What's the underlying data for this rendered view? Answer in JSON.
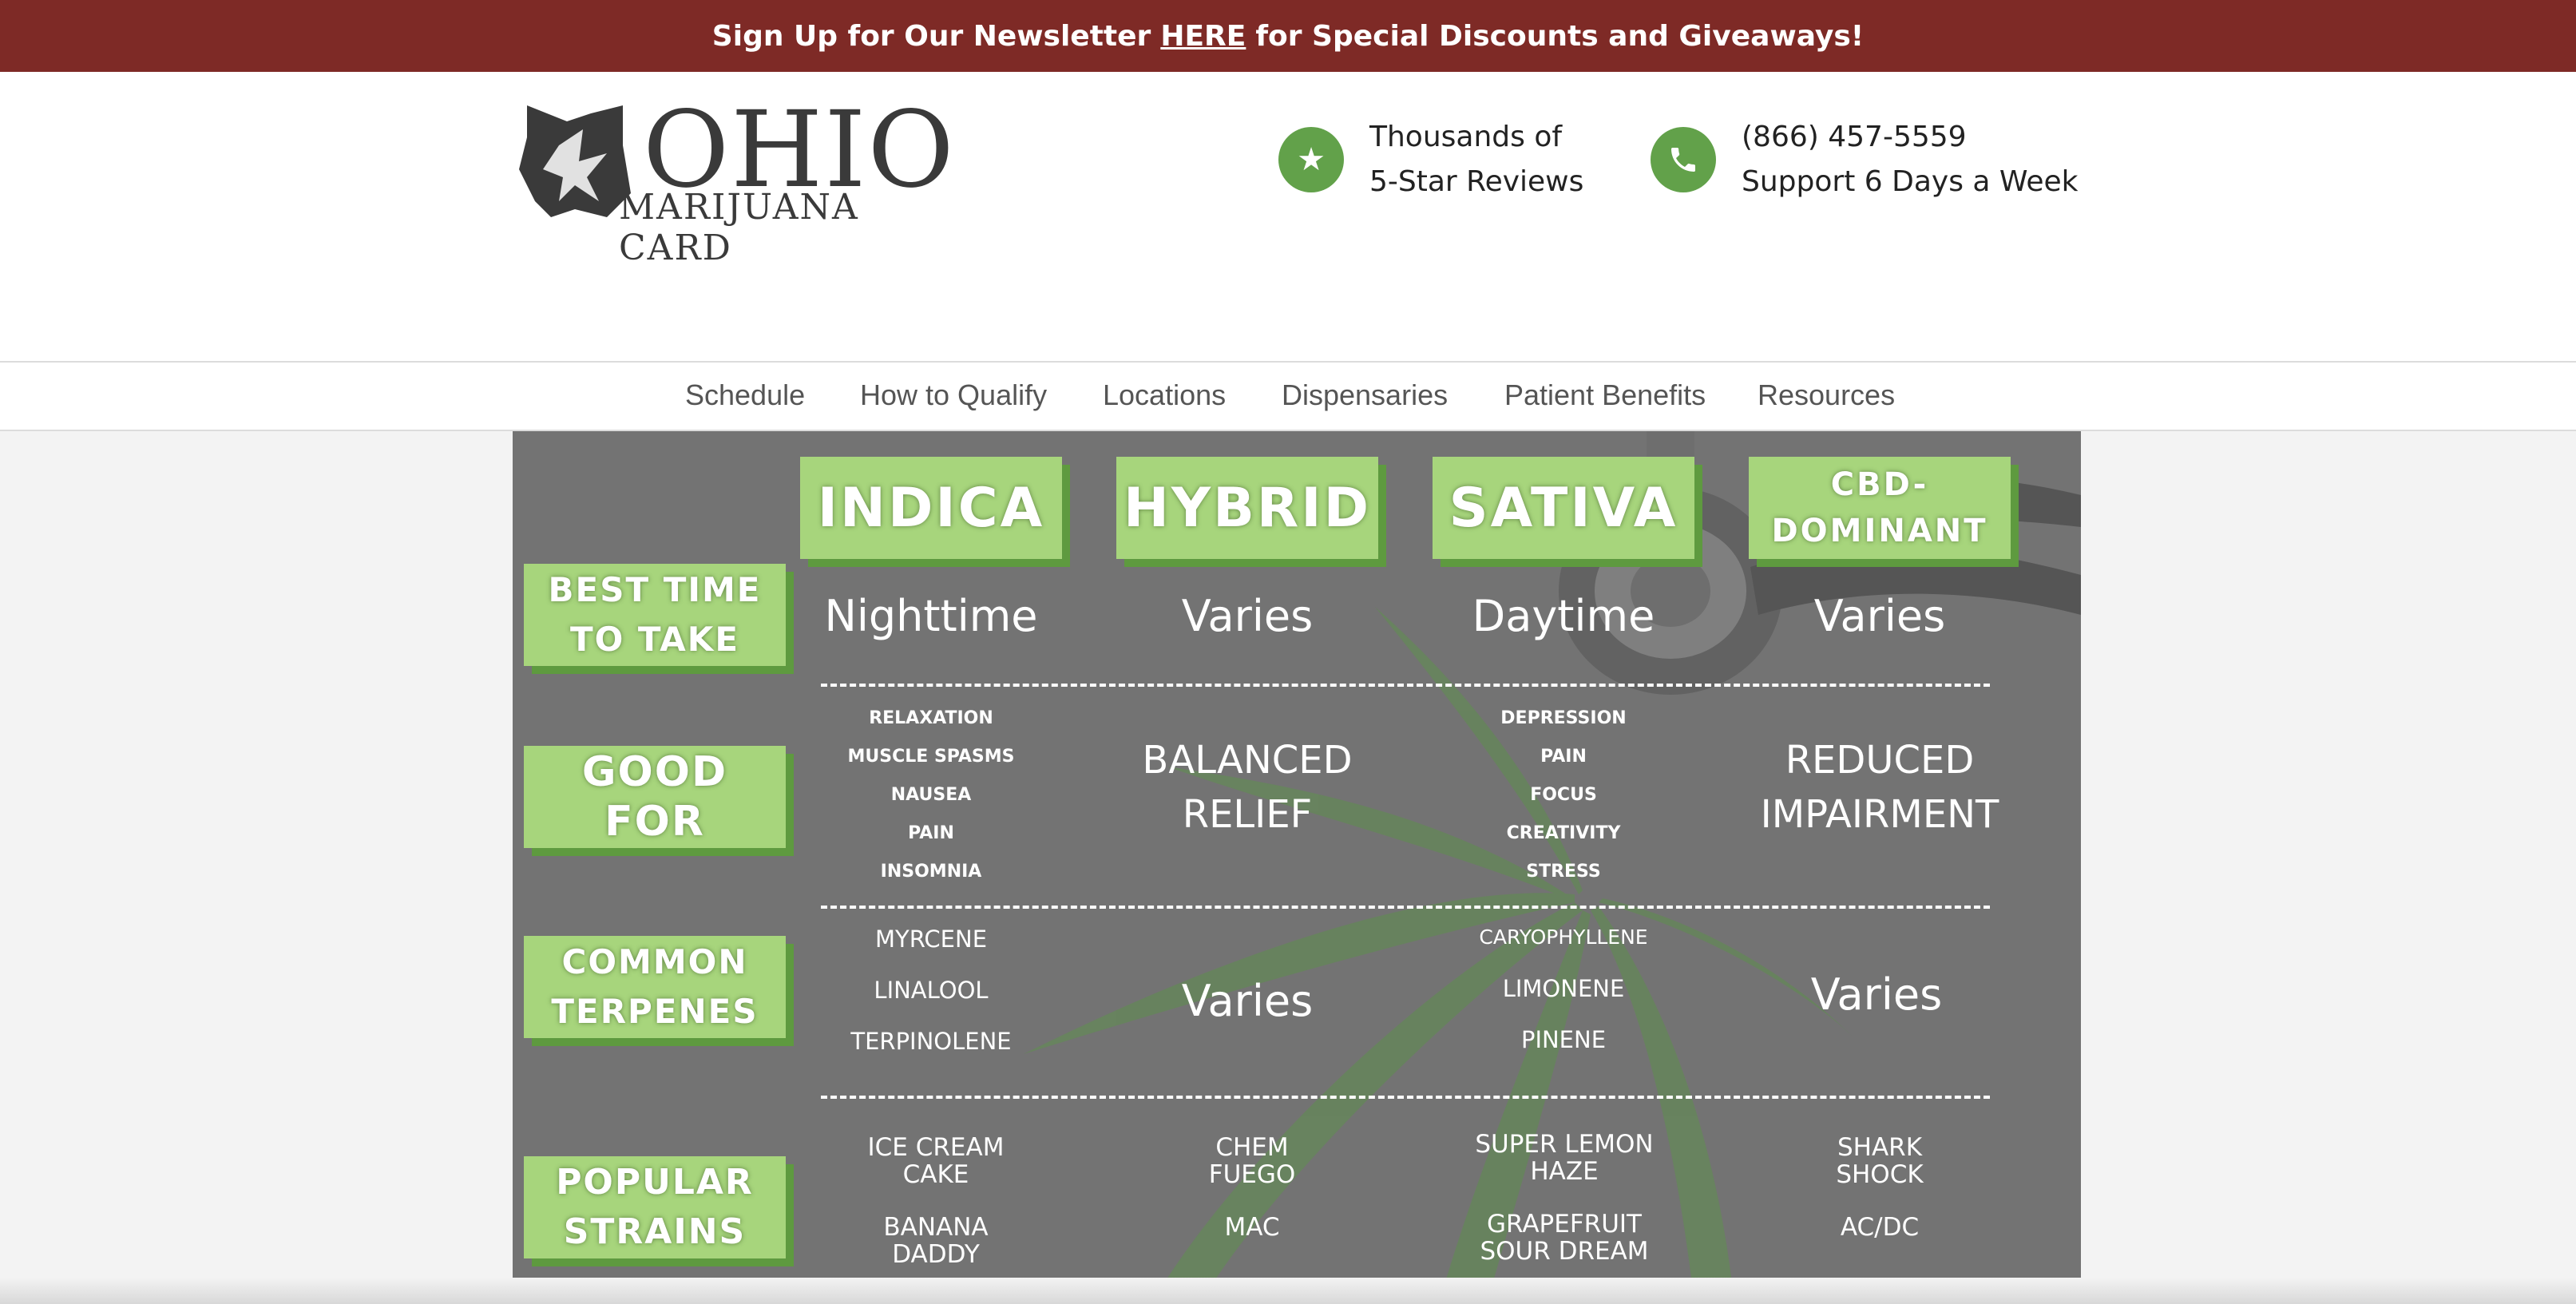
{
  "banner": {
    "before": "Sign Up for Our Newsletter",
    "link": "HERE",
    "after": "for Special Discounts and Giveaways!"
  },
  "logo": {
    "big": "OHIO",
    "small": "MARIJUANA CARD"
  },
  "reviews": {
    "line1": "Thousands of",
    "line2": "5-Star Reviews",
    "icon": "star-icon"
  },
  "phone": {
    "line1": "(866) 457-5559",
    "line2": " Support 6 Days a Week",
    "icon": "phone-icon"
  },
  "nav": [
    "Schedule",
    "How to Qualify",
    "Locations",
    "Dispensaries",
    "Patient Benefits",
    "Resources"
  ],
  "colors": {
    "banner": "#7e2a26",
    "accent_green": "#62a14a",
    "label_green": "#a7d57c",
    "chart_bg": "#737373"
  },
  "chart": {
    "columns": [
      "INDICA",
      "HYBRID",
      "SATIVA",
      "CBD-\nDOMINANT"
    ],
    "rows": [
      "BEST TIME\nTO TAKE",
      "GOOD FOR",
      "COMMON\nTERPENES",
      "POPULAR\nSTRAINS"
    ],
    "best_time": [
      "Nighttime",
      "Varies",
      "Daytime",
      "Varies"
    ],
    "good_for": {
      "indica": [
        "RELAXATION",
        "MUSCLE SPASMS",
        "NAUSEA",
        "PAIN",
        "INSOMNIA"
      ],
      "hybrid": "BALANCED\nRELIEF",
      "sativa": [
        "DEPRESSION",
        "PAIN",
        "FOCUS",
        "CREATIVITY",
        "STRESS"
      ],
      "cbd": "REDUCED\nIMPAIRMENT"
    },
    "terpenes": {
      "indica": [
        "MYRCENE",
        "LINALOOL",
        "TERPINOLENE"
      ],
      "hybrid": "Varies",
      "sativa": [
        "CARYOPHYLLENE",
        "LIMONENE",
        "PINENE"
      ],
      "cbd": "Varies"
    },
    "strains": {
      "indica": [
        "ICE CREAM\nCAKE",
        "BANANA\nDADDY"
      ],
      "hybrid": [
        "CHEM\nFUEGO",
        "MAC"
      ],
      "sativa": [
        "SUPER LEMON\nHAZE",
        "GRAPEFRUIT\nSOUR DREAM"
      ],
      "cbd": [
        "SHARK\nSHOCK",
        "AC/DC"
      ]
    }
  }
}
